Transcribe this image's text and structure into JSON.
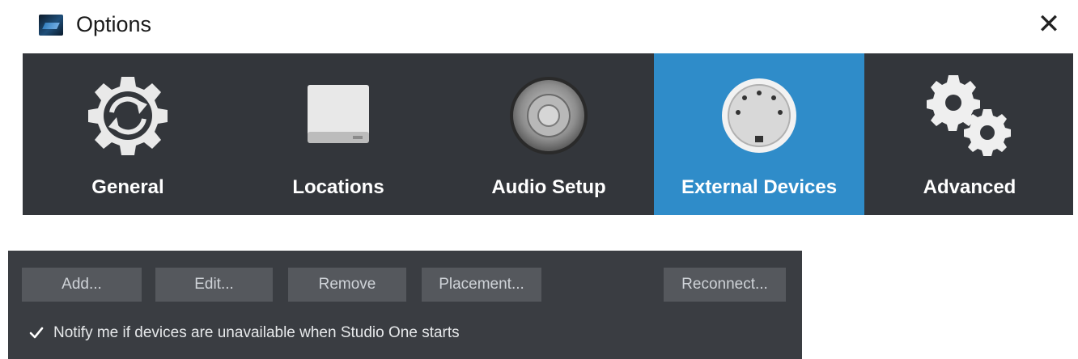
{
  "window": {
    "title": "Options",
    "close_label": "✕"
  },
  "tabs": [
    {
      "label": "General",
      "icon": "gear-sync-icon",
      "active": false
    },
    {
      "label": "Locations",
      "icon": "drive-icon",
      "active": false
    },
    {
      "label": "Audio Setup",
      "icon": "speaker-icon",
      "active": false
    },
    {
      "label": "External Devices",
      "icon": "midi-connector-icon",
      "active": true
    },
    {
      "label": "Advanced",
      "icon": "gears-icon",
      "active": false
    }
  ],
  "devices_panel": {
    "buttons": {
      "add": "Add...",
      "edit": "Edit...",
      "remove": "Remove",
      "placement": "Placement...",
      "reconnect": "Reconnect..."
    },
    "notify_checkbox": {
      "checked": true,
      "label": "Notify me if devices are unavailable when Studio One starts"
    }
  },
  "colors": {
    "active_tab": "#2f8cc9",
    "category_bar": "#33363b",
    "panel_bg": "#3a3d42",
    "button_bg": "#55585d"
  }
}
